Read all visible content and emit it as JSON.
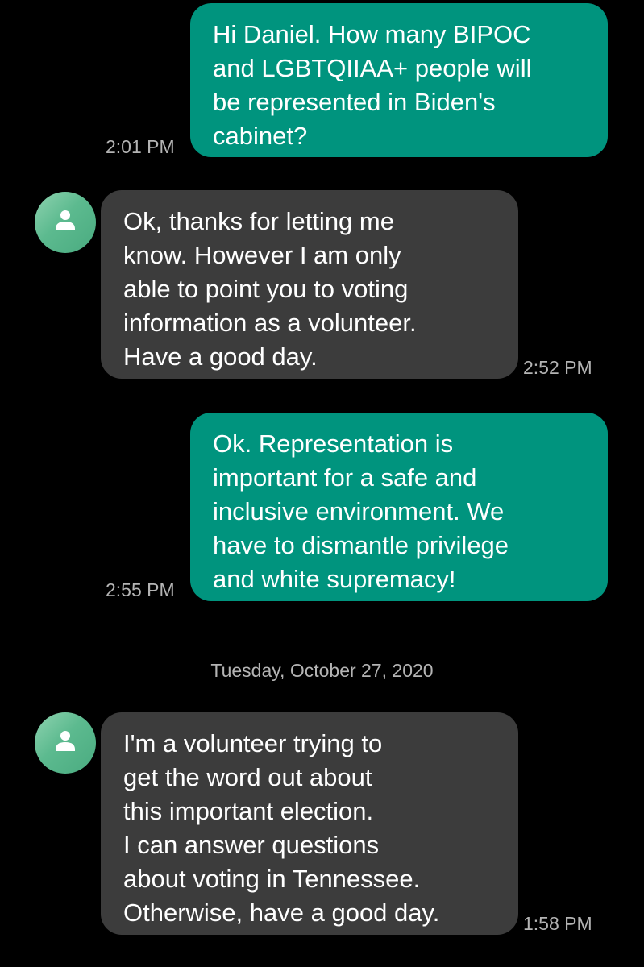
{
  "conversation": {
    "messages": [
      {
        "direction": "outgoing",
        "text": "Hi Daniel.  How many BIPOC\nand LGBTQIIAA+ people will\nbe represented in Biden's\ncabinet?",
        "time": "2:01 PM"
      },
      {
        "direction": "incoming",
        "text": "Ok, thanks for letting me\nknow. However I am only\nable to point you to voting\ninformation as a volunteer.\nHave a good day.",
        "time": "2:52 PM"
      },
      {
        "direction": "outgoing",
        "text": "Ok. Representation is\nimportant for a safe and\ninclusive environment. We\nhave to dismantle privilege\nand white supremacy!",
        "time": "2:55 PM"
      },
      {
        "direction": "incoming",
        "text": "I'm a volunteer trying to\nget the word out about\nthis important election.\nI can answer questions\nabout voting in Tennessee.\nOtherwise, have a good day.",
        "time": "1:58 PM"
      }
    ],
    "date_separator": "Tuesday, October 27, 2020"
  },
  "colors": {
    "background": "#000000",
    "outgoing_bubble": "#00947e",
    "incoming_bubble": "#3c3c3c",
    "timestamp": "#b4b4b4",
    "avatar": "#5cba8f"
  },
  "icons": {
    "avatar": "contact-person-icon"
  }
}
